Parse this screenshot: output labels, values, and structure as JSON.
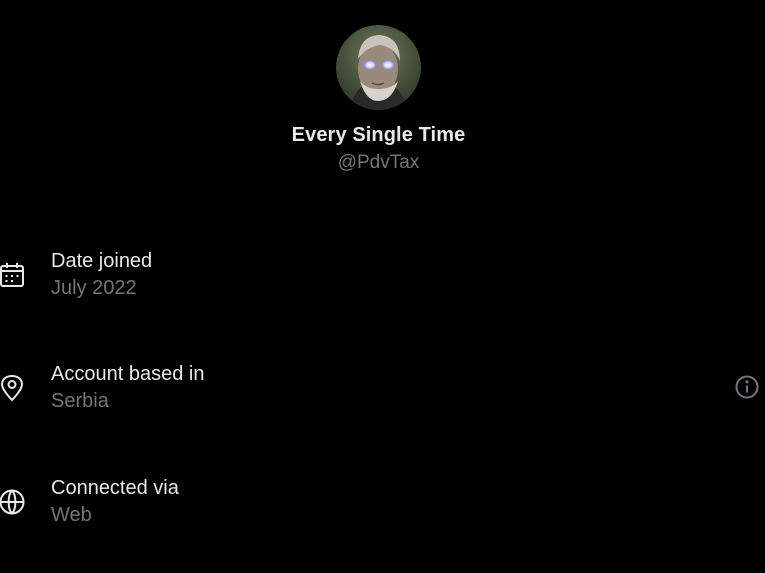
{
  "profile": {
    "display_name": "Every Single Time",
    "handle": "@PdvTax"
  },
  "rows": [
    {
      "label": "Date joined",
      "value": "July 2022",
      "icon": "calendar-icon"
    },
    {
      "label": "Account based in",
      "value": "Serbia",
      "icon": "location-pin-icon",
      "extra_icon": "info-icon"
    },
    {
      "label": "Connected via",
      "value": "Web",
      "icon": "globe-icon"
    }
  ],
  "colors": {
    "background": "#000000",
    "primary_text": "#e7e9ea",
    "secondary_text": "#71767b"
  }
}
